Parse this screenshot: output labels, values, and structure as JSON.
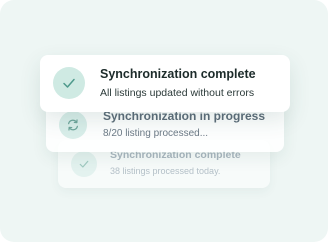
{
  "colors": {
    "background": "#eef6f4",
    "accent": "#4e9a8c",
    "icon_bg": "#cfeae3"
  },
  "notifications": [
    {
      "icon": "check-icon",
      "title": "Synchronization complete",
      "subtitle": "All listings updated without errors"
    },
    {
      "icon": "sync-icon",
      "title": "Synchronization in progress",
      "subtitle": "8/20 listing processed..."
    },
    {
      "icon": "check-icon",
      "title": "Synchronization complete",
      "subtitle": "38 listings processed today."
    }
  ]
}
